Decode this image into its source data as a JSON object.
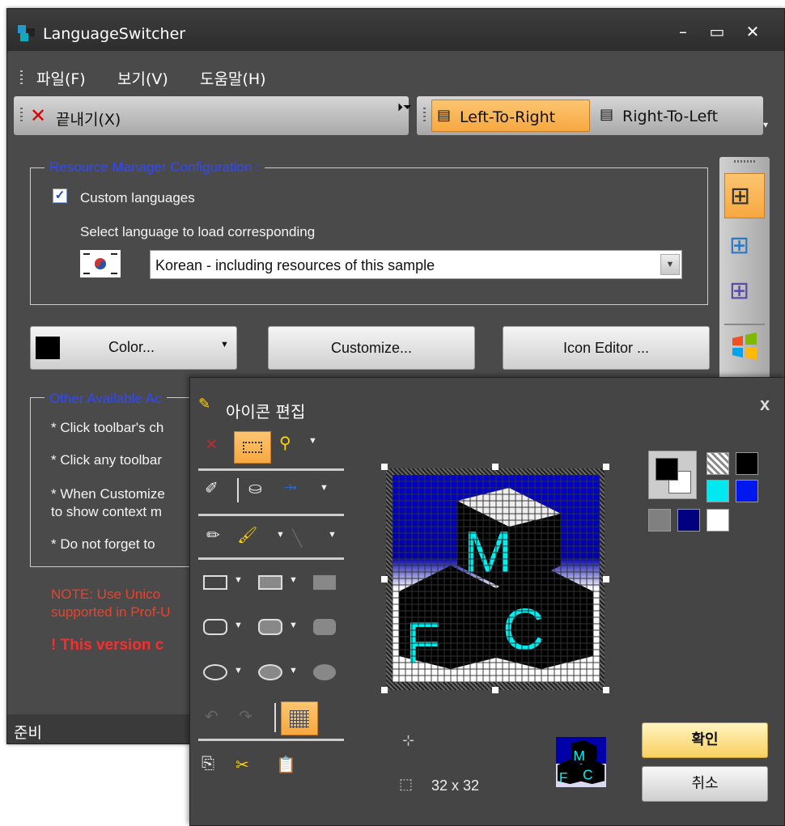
{
  "window": {
    "title": "LanguageSwitcher",
    "min": "–",
    "max": "▭",
    "close": "✕"
  },
  "menu": {
    "items": [
      "파일(F)",
      "보기(V)",
      "도움말(H)"
    ]
  },
  "toolbar1": {
    "exit_label": "끝내기(X)"
  },
  "toolbar2": {
    "ltr_label": "Left-To-Right",
    "rtl_label": "Right-To-Left"
  },
  "resource": {
    "group_label": "Resource Manager Configuration :",
    "custom_languages": "Custom languages",
    "select_text": "Select language to load corresponding",
    "selected_language": "Korean - including resources of this sample"
  },
  "buttons": {
    "color": "Color...",
    "customize": "Customize...",
    "icon_editor": "Icon Editor ..."
  },
  "other": {
    "group_label": "Other Available Ac",
    "line1": "* Click toolbar's ch",
    "line2": "* Click any toolbar",
    "line3a": "* When Customize",
    "line3b": "to show context m",
    "line4": "* Do not forget to",
    "note1": "NOTE: Use Unico",
    "note2": "supported in Prof-U",
    "warning": "! This version c"
  },
  "status": {
    "text": "준비"
  },
  "icon_editor": {
    "title": "아이콘 편집",
    "close": "x",
    "size": "32 x 32",
    "ok": "확인",
    "cancel": "취소"
  },
  "colors": {
    "accent": "#f7a840",
    "blue_text": "#2f49ff",
    "red_text": "#ff2b2b",
    "note_red": "#e8432f"
  }
}
